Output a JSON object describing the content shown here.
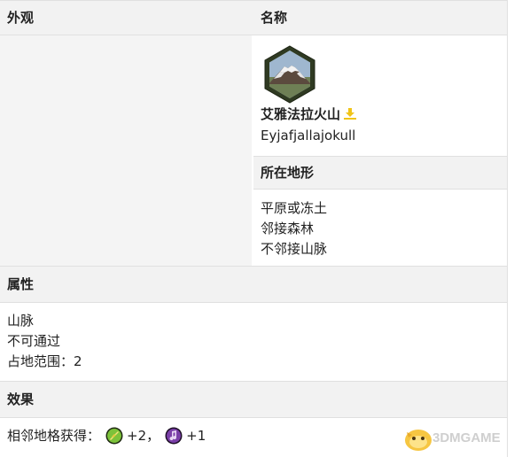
{
  "header": {
    "appearance_label": "外观",
    "name_label": "名称"
  },
  "wonder": {
    "name_cn": "艾雅法拉火山",
    "name_en": "Eyjafjallajokull"
  },
  "terrain": {
    "label": "所在地形",
    "items": [
      "平原或冻土",
      "邻接森林",
      "不邻接山脉"
    ]
  },
  "properties": {
    "label": "属性",
    "items": [
      "山脉",
      "不可通过",
      "占地范围：2"
    ]
  },
  "effects": {
    "label": "效果",
    "prefix": "相邻地格获得：",
    "bonus_food": "+2",
    "separator": "，",
    "bonus_culture": "+1"
  },
  "watermark": {
    "text": "3DMGAME"
  },
  "icons": {
    "wonder": "volcano-hex-icon",
    "download": "download-icon",
    "food": "food-yield-icon",
    "culture": "culture-yield-icon",
    "logo": "3dm-mascot-icon"
  }
}
